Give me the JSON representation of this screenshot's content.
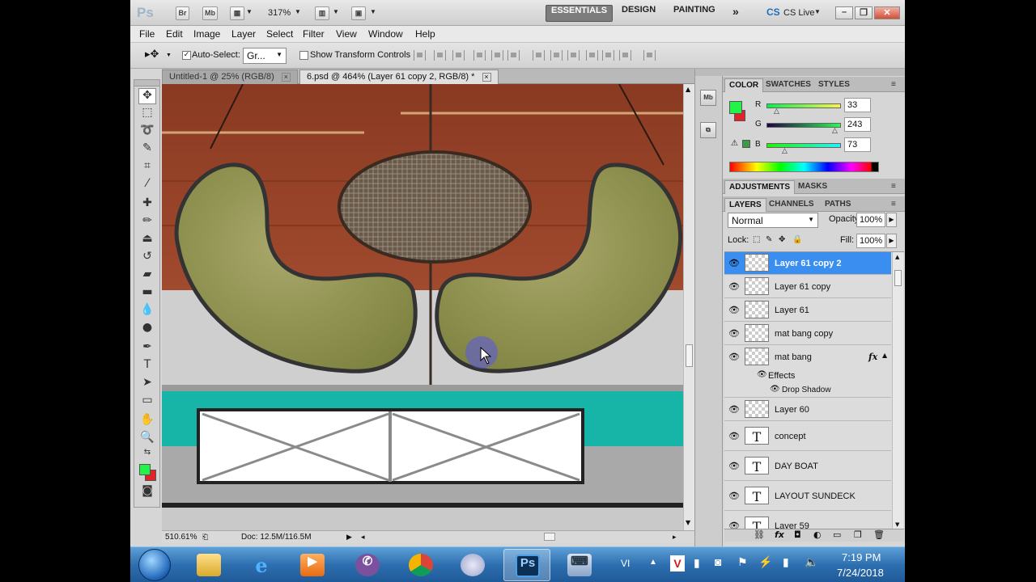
{
  "appbar": {
    "logo": "Ps",
    "bridge": "Br",
    "minibridge": "Mb",
    "zoom": "317%",
    "workspaces": [
      "ESSENTIALS",
      "DESIGN",
      "PAINTING"
    ],
    "more": "»",
    "cslive": "CS Live"
  },
  "menu": [
    "File",
    "Edit",
    "Image",
    "Layer",
    "Select",
    "Filter",
    "View",
    "Window",
    "Help"
  ],
  "options": {
    "auto_select_label": "Auto-Select:",
    "auto_select_value": "Gr...",
    "show_transform": "Show Transform Controls"
  },
  "doc_tabs": [
    {
      "label": "Untitled-1 @ 25% (RGB/8)",
      "active": false
    },
    {
      "label": "6.psd @ 464% (Layer 61 copy 2, RGB/8) *",
      "active": true
    }
  ],
  "status": {
    "zoom": "510.61%",
    "doc": "Doc: 12.5M/116.5M"
  },
  "color_panel": {
    "tabs": [
      "COLOR",
      "SWATCHES",
      "STYLES"
    ],
    "r_label": "R",
    "g_label": "G",
    "b_label": "B",
    "r": "33",
    "g": "243",
    "b": "73",
    "fg": "#21f349",
    "bg": "#e3212a"
  },
  "adjust_panel": {
    "tabs": [
      "ADJUSTMENTS",
      "MASKS"
    ]
  },
  "layers_panel": {
    "tabs": [
      "LAYERS",
      "CHANNELS",
      "PATHS"
    ],
    "blend_mode": "Normal",
    "opacity_label": "Opacity:",
    "opacity": "100%",
    "lock_label": "Lock:",
    "fill_label": "Fill:",
    "fill": "100%",
    "effects_label": "Effects",
    "drop_shadow_label": "Drop Shadow",
    "fx": "fx",
    "layers": [
      {
        "name": "Layer 61 copy 2",
        "type": "raster",
        "selected": true
      },
      {
        "name": "Layer 61 copy",
        "type": "raster",
        "selected": false
      },
      {
        "name": "Layer 61",
        "type": "raster",
        "selected": false
      },
      {
        "name": "mat bang copy",
        "type": "raster",
        "selected": false
      },
      {
        "name": "mat bang",
        "type": "raster",
        "selected": false
      },
      {
        "name": "Layer 60",
        "type": "raster",
        "selected": false
      },
      {
        "name": "concept",
        "type": "text",
        "selected": false
      },
      {
        "name": "DAY BOAT",
        "type": "text",
        "selected": false
      },
      {
        "name": "LAYOUT SUNDECK",
        "type": "text",
        "selected": false
      },
      {
        "name": "Layer 59",
        "type": "text",
        "selected": false
      }
    ]
  },
  "taskbar": {
    "lang": "VI",
    "time": "7:19 PM",
    "date": "7/24/2018",
    "ps_label": "Ps"
  }
}
